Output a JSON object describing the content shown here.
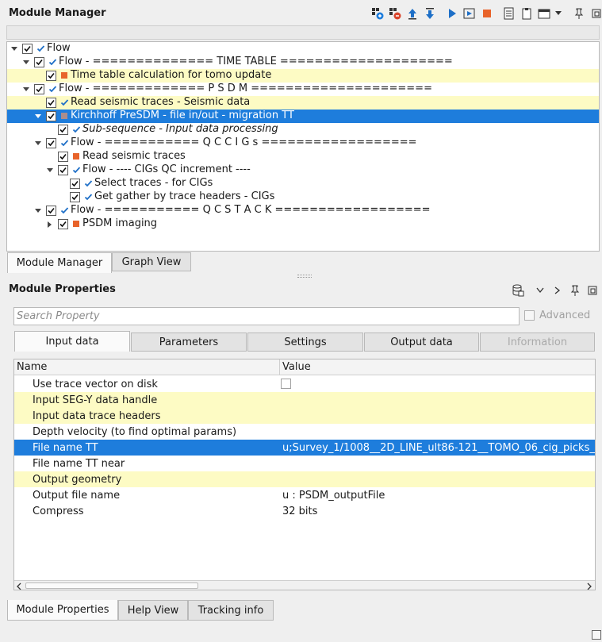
{
  "module_manager": {
    "title": "Module Manager",
    "toolbar": [
      "add-module-icon",
      "remove-module-icon",
      "move-up-icon",
      "move-down-icon",
      "run-icon",
      "run-step-icon",
      "stop-icon",
      "copy-icon",
      "paste-icon",
      "window-icon",
      "menu-arrow-icon",
      "pin-icon",
      "float-icon"
    ],
    "tree": [
      {
        "label": "Flow",
        "level": 0,
        "expander": "open",
        "checked": true,
        "mark": "tick",
        "style": "",
        "italic": false
      },
      {
        "label": "Flow - ============== TIME TABLE ====================",
        "level": 1,
        "expander": "open",
        "checked": true,
        "mark": "tick",
        "style": "",
        "italic": false
      },
      {
        "label": "Time table calculation for tomo update",
        "level": 2,
        "expander": "",
        "checked": true,
        "mark": "square",
        "style": "hl",
        "italic": false
      },
      {
        "label": "Flow - ============= P S D M =====================",
        "level": 1,
        "expander": "open",
        "checked": true,
        "mark": "tick",
        "style": "",
        "italic": false
      },
      {
        "label": "Read seismic traces - Seismic data",
        "level": 2,
        "expander": "",
        "checked": true,
        "mark": "tick",
        "style": "hl",
        "italic": false
      },
      {
        "label": "Kirchhoff PreSDM - file in/out - migration TT",
        "level": 2,
        "expander": "open",
        "checked": true,
        "mark": "square-grey",
        "style": "sel",
        "italic": false
      },
      {
        "label": "Sub-sequence - Input data processing",
        "level": 3,
        "expander": "",
        "checked": true,
        "mark": "tick",
        "style": "",
        "italic": true
      },
      {
        "label": "Flow - =========== Q C  C I G s ==================",
        "level": 2,
        "expander": "open",
        "checked": true,
        "mark": "tick",
        "style": "",
        "italic": false
      },
      {
        "label": "Read seismic traces",
        "level": 3,
        "expander": "",
        "checked": true,
        "mark": "square",
        "style": "",
        "italic": false
      },
      {
        "label": "Flow - ---- CIGs QC increment ----",
        "level": 3,
        "expander": "open",
        "checked": true,
        "mark": "tick",
        "style": "",
        "italic": false
      },
      {
        "label": "Select traces - for CIGs",
        "level": 4,
        "expander": "",
        "checked": true,
        "mark": "tick",
        "style": "",
        "italic": false
      },
      {
        "label": "Get gather by trace headers - CIGs",
        "level": 4,
        "expander": "",
        "checked": true,
        "mark": "tick",
        "style": "",
        "italic": false
      },
      {
        "label": "Flow - ===========  Q C    S T A C K  ==================",
        "level": 2,
        "expander": "open",
        "checked": true,
        "mark": "tick",
        "style": "",
        "italic": false
      },
      {
        "label": "PSDM imaging",
        "level": 3,
        "expander": "closed",
        "checked": true,
        "mark": "square",
        "style": "",
        "italic": false
      }
    ],
    "tabs": [
      "Module Manager",
      "Graph View"
    ]
  },
  "module_properties": {
    "title": "Module Properties",
    "search_placeholder": "Search Property",
    "advanced_label": "Advanced",
    "tabs": [
      {
        "label": "Input data",
        "state": "active"
      },
      {
        "label": "Parameters",
        "state": ""
      },
      {
        "label": "Settings",
        "state": ""
      },
      {
        "label": "Output data",
        "state": ""
      },
      {
        "label": "Information",
        "state": "dis"
      }
    ],
    "columns": {
      "name": "Name",
      "value": "Value"
    },
    "rows": [
      {
        "name": "Use trace vector on disk",
        "value": "",
        "checkbox": true,
        "style": ""
      },
      {
        "name": "Input SEG-Y data handle",
        "value": "",
        "checkbox": false,
        "style": "hl"
      },
      {
        "name": "Input data trace headers",
        "value": "",
        "checkbox": false,
        "style": "hl"
      },
      {
        "name": "Depth velocity (to find optimal params)",
        "value": "",
        "checkbox": false,
        "style": ""
      },
      {
        "name": "File name TT",
        "value": "u;Survey_1/1008__2D_LINE_ult86-121__TOMO_06_cig_picks_",
        "checkbox": false,
        "style": "sel"
      },
      {
        "name": "File name TT near",
        "value": "",
        "checkbox": false,
        "style": ""
      },
      {
        "name": "Output geometry",
        "value": "",
        "checkbox": false,
        "style": "hl"
      },
      {
        "name": "Output file name",
        "value": "u : PSDM_outputFile",
        "checkbox": false,
        "style": ""
      },
      {
        "name": "Compress",
        "value": "32 bits",
        "checkbox": false,
        "style": ""
      }
    ],
    "bottom_tabs": [
      "Module Properties",
      "Help View",
      "Tracking info"
    ]
  },
  "colors": {
    "selection": "#1e7ddc",
    "highlight": "#fdfbc4",
    "square": "#e8632a"
  }
}
